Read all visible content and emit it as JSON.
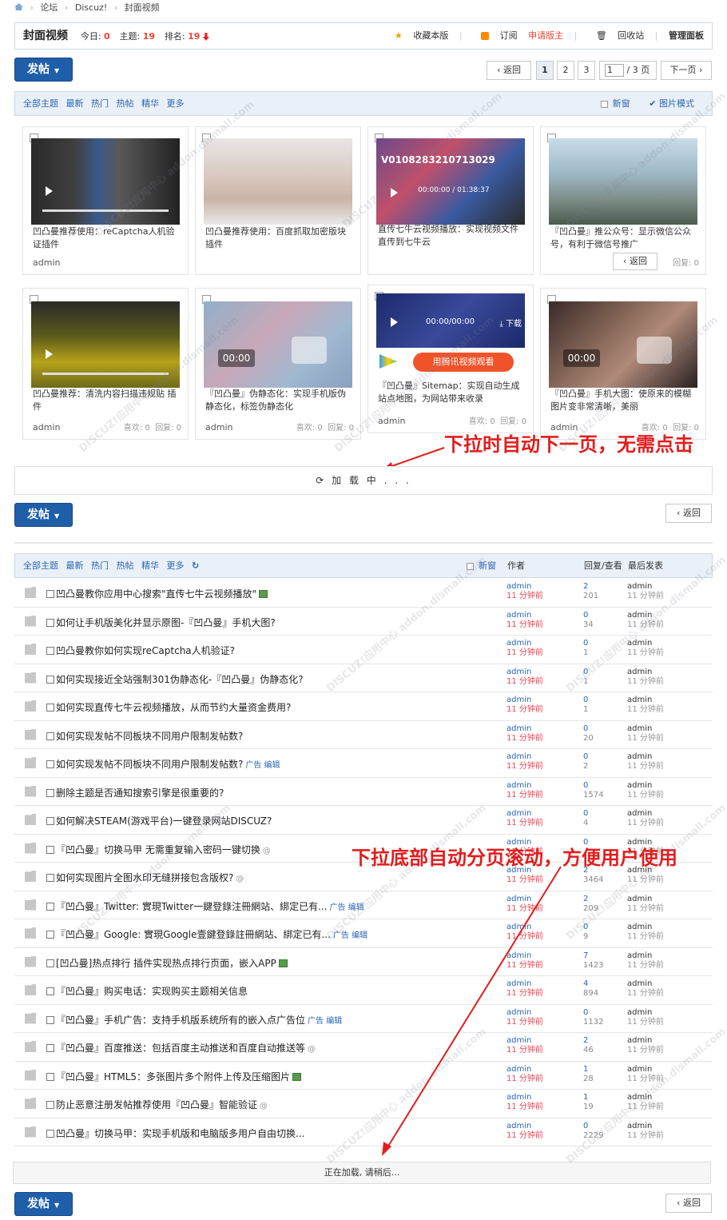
{
  "breadcrumb": {
    "items": [
      "论坛",
      "Discuz!",
      "封面视频"
    ]
  },
  "forum": {
    "title": "封面视频",
    "today_label": "今日:",
    "today_value": "0",
    "topics_label": "主题:",
    "topics_value": "19",
    "rank_label": "排名:",
    "rank_value": "19",
    "fav": "收藏本版",
    "sub": "订阅",
    "apply": "申请版主",
    "recycle": "回收站",
    "admin": "管理面板"
  },
  "post_button": {
    "label": "发帖"
  },
  "pagination": {
    "back": "返回",
    "pages": [
      "1",
      "2",
      "3"
    ],
    "page_input": "1",
    "total": "/ 3 页",
    "next": "下一页"
  },
  "filter": {
    "items": [
      "全部主题",
      "最新",
      "热门",
      "热帖",
      "精华",
      "更多"
    ],
    "newwin": "新窗",
    "picmode": "图片模式"
  },
  "cards": [
    {
      "title": "凹凸曼推荐使用：reCaptcha人机验证插件",
      "user": "admin",
      "likes": "",
      "replies": ""
    },
    {
      "title": "凹凸曼推荐使用：百度抓取加密版块插件",
      "user": "",
      "likes": "",
      "replies": ""
    },
    {
      "title": "直传七牛云视频播放：实现视频文件直传到七牛云",
      "user": "",
      "likes": "",
      "replies": "",
      "overlay": "V010828321071302​9",
      "time": "00:00:00 / 01:38:37"
    },
    {
      "title": "『凹凸曼』推公众号：显示微信公众号，有利于微信号推广",
      "user": "",
      "likes": "",
      "replies": "回复: 0",
      "back": "返回"
    },
    {
      "title": "凹凸曼推荐：清洗内容扫描违规贴 插件",
      "user": "admin",
      "likes": "喜欢: 0",
      "replies": "回复: 0"
    },
    {
      "title": "『凹凸曼』伪静态化：实现手机版伪静态化，标签伪静态化",
      "user": "admin",
      "likes": "喜欢: 0",
      "replies": "回复: 0",
      "time": "00:00"
    },
    {
      "title": "『凹凸曼』Sitemap：实现自动生成站点地图，为网站带来收录",
      "user": "admin",
      "likes": "喜欢: 0",
      "replies": "回复: 0",
      "time": "00:00/00:00",
      "download": "下载",
      "tencent": "用腾讯视频观看"
    },
    {
      "title": "『凹凸曼』手机大图：使原来的模糊图片变非常清晰，美丽",
      "user": "admin",
      "likes": "喜欢: 0",
      "replies": "回复: 0",
      "time": "00:00"
    }
  ],
  "loading1": "加 载 中 . . .",
  "annotation1": "下拉时自动下一页，无需点击",
  "annotation2": "下拉底部自动分页滚动，方便用户使用",
  "list_header": {
    "items": [
      "全部主题",
      "最新",
      "热门",
      "热帖",
      "精华",
      "更多"
    ],
    "newwin": "新窗",
    "author": "作者",
    "replies_views": "回复/查看",
    "last": "最后发表"
  },
  "threads": [
    {
      "title": "凹凸曼教你应用中心搜索\"直传七牛云视频播放\"",
      "tag": "",
      "icon": "img",
      "author": "admin",
      "time": "11 分钟前",
      "replies": "2",
      "views": "201",
      "last": "admin",
      "ltime": "11 分钟前"
    },
    {
      "title": "如何让手机版美化并显示原图-『凹凸曼』手机大图?",
      "tag": "",
      "icon": "",
      "author": "admin",
      "time": "11 分钟前",
      "replies": "0",
      "views": "34",
      "last": "admin",
      "ltime": "11 分钟前"
    },
    {
      "title": "凹凸曼教你如何实现reCaptcha人机验证?",
      "tag": "",
      "icon": "",
      "author": "admin",
      "time": "11 分钟前",
      "replies": "0",
      "views": "1",
      "last": "admin",
      "ltime": "11 分钟前"
    },
    {
      "title": "如何实现接近全站强制301伪静态化-『凹凸曼』伪静态化?",
      "tag": "",
      "icon": "",
      "author": "admin",
      "time": "11 分钟前",
      "replies": "0",
      "views": "1",
      "last": "admin",
      "ltime": "11 分钟前"
    },
    {
      "title": "如何实现直传七牛云视频播放，从而节约大量资金费用?",
      "tag": "",
      "icon": "",
      "author": "admin",
      "time": "11 分钟前",
      "replies": "0",
      "views": "1",
      "last": "admin",
      "ltime": "11 分钟前"
    },
    {
      "title": "如何实现发帖不同板块不同用户限制发帖数?",
      "tag": "",
      "icon": "",
      "author": "admin",
      "time": "11 分钟前",
      "replies": "0",
      "views": "20",
      "last": "admin",
      "ltime": "11 分钟前"
    },
    {
      "title": "如何实现发帖不同板块不同用户限制发帖数?",
      "tag": "广告 编辑",
      "icon": "",
      "author": "admin",
      "time": "11 分钟前",
      "replies": "0",
      "views": "2",
      "last": "admin",
      "ltime": "11 分钟前"
    },
    {
      "title": "删除主题是否通知搜索引擎是很重要的?",
      "tag": "",
      "icon": "",
      "author": "admin",
      "time": "11 分钟前",
      "replies": "0",
      "views": "1574",
      "last": "admin",
      "ltime": "11 分钟前"
    },
    {
      "title": "如何解决STEAM(游戏平台)一键登录网站DISCUZ?",
      "tag": "",
      "icon": "",
      "author": "admin",
      "time": "11 分钟前",
      "replies": "0",
      "views": "4",
      "last": "admin",
      "ltime": "11 分钟前"
    },
    {
      "title": "『凹凸曼』切换马甲 无需重复输入密码一键切换",
      "tag": "",
      "icon": "at",
      "author": "admin",
      "time": "11 分钟前",
      "replies": "0",
      "views": "",
      "last": "admin",
      "ltime": "11 分钟前"
    },
    {
      "title": "如何实现图片全图水印无缝拼接包含版权?",
      "tag": "",
      "icon": "at",
      "author": "admin",
      "time": "11 分钟前",
      "replies": "2",
      "views": "3464",
      "last": "admin",
      "ltime": "11 分钟前"
    },
    {
      "title": "『凹凸曼』Twitter: 實現Twitter一鍵登錄注冊網站、綁定已有...",
      "tag": "广告 编辑",
      "icon": "",
      "author": "admin",
      "time": "11 分钟前",
      "replies": "2",
      "views": "209",
      "last": "admin",
      "ltime": "11 分钟前"
    },
    {
      "title": "『凹凸曼』Google: 實現Google壹鍵登錄註冊網站、綁定已有...",
      "tag": "广告 编辑",
      "icon": "",
      "author": "admin",
      "time": "11 分钟前",
      "replies": "0",
      "views": "9",
      "last": "admin",
      "ltime": "11 分钟前"
    },
    {
      "title": "[凹凸曼]热点排行 插件实现热点排行页面，嵌入APP",
      "tag": "",
      "icon": "img",
      "author": "admin",
      "time": "11 分钟前",
      "replies": "7",
      "views": "1423",
      "last": "admin",
      "ltime": "11 分钟前"
    },
    {
      "title": "『凹凸曼』购买电话：实现购买主题相关信息",
      "tag": "",
      "icon": "",
      "author": "admin",
      "time": "11 分钟前",
      "replies": "4",
      "views": "894",
      "last": "admin",
      "ltime": "11 分钟前"
    },
    {
      "title": "『凹凸曼』手机广告：支持手机版系统所有的嵌入点广告位",
      "tag": "广告 编辑",
      "icon": "",
      "author": "admin",
      "time": "11 分钟前",
      "replies": "0",
      "views": "1132",
      "last": "admin",
      "ltime": "11 分钟前"
    },
    {
      "title": "『凹凸曼』百度推送：包括百度主动推送和百度自动推送等",
      "tag": "",
      "icon": "at",
      "author": "admin",
      "time": "11 分钟前",
      "replies": "2",
      "views": "46",
      "last": "admin",
      "ltime": "11 分钟前"
    },
    {
      "title": "『凹凸曼』HTML5：多张图片多个附件上传及压缩图片",
      "tag": "",
      "icon": "img",
      "author": "admin",
      "time": "11 分钟前",
      "replies": "1",
      "views": "28",
      "last": "admin",
      "ltime": "11 分钟前"
    },
    {
      "title": "防止恶意注册发帖推荐使用『凹凸曼』智能验证",
      "tag": "",
      "icon": "at",
      "author": "admin",
      "time": "11 分钟前",
      "replies": "1",
      "views": "19",
      "last": "admin",
      "ltime": "11 分钟前"
    },
    {
      "title": "凹凸曼』切换马甲：实现手机版和电脑版多用户自由切换...",
      "tag": "",
      "icon": "",
      "author": "admin",
      "time": "11 分钟前",
      "replies": "0",
      "views": "2229",
      "last": "admin",
      "ltime": "11 分钟前"
    }
  ],
  "loading2": "正在加载, 请稍后...",
  "watermark": "DISCUZ!应用中心 addon.dismall.com",
  "colors": {
    "accent": "#1f5ea8",
    "annotation": "#e21d1d",
    "link": "#2a66b2"
  }
}
